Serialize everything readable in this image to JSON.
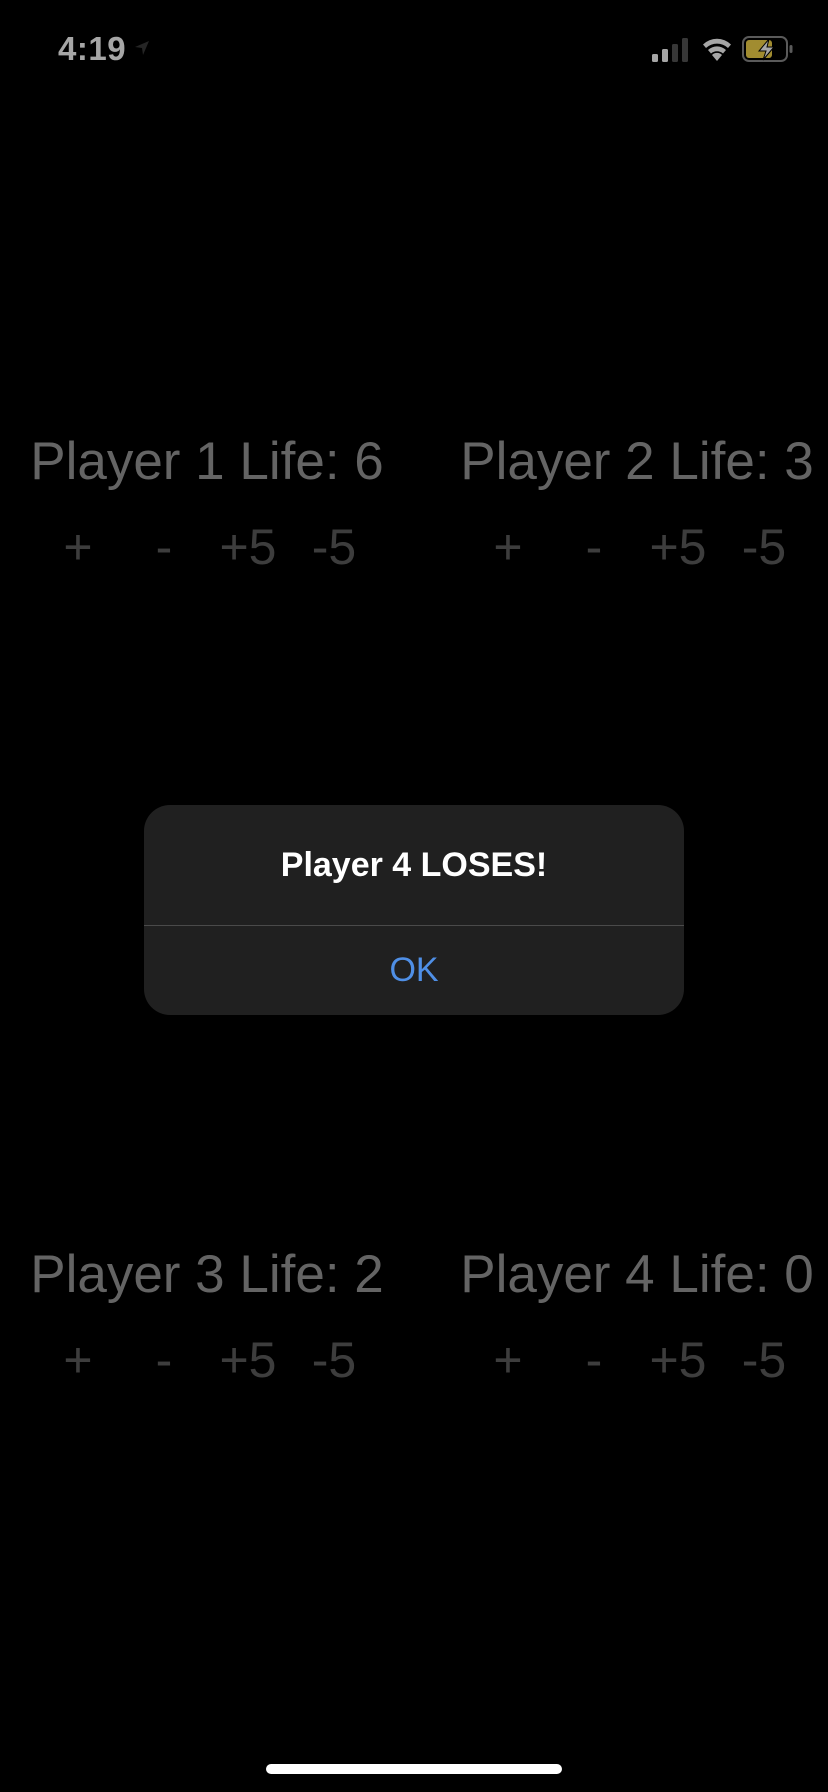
{
  "status_bar": {
    "time": "4:19",
    "icons": [
      "location-arrow-icon",
      "cellular-signal-icon",
      "wifi-icon",
      "battery-charging-icon"
    ],
    "battery_color": "#f7d84a"
  },
  "players": [
    {
      "title": "Player 1 Life: 6",
      "controls": [
        "+",
        "-",
        "+5",
        "-5"
      ]
    },
    {
      "title": "Player 2 Life: 3",
      "controls": [
        "+",
        "-",
        "+5",
        "-5"
      ]
    },
    {
      "title": "Player 3 Life: 2",
      "controls": [
        "+",
        "-",
        "+5",
        "-5"
      ]
    },
    {
      "title": "Player 4 Life: 0",
      "controls": [
        "+",
        "-",
        "+5",
        "-5"
      ]
    }
  ],
  "alert": {
    "title": "Player 4 LOSES!",
    "ok_label": "OK",
    "ok_color": "#4f8fe6"
  },
  "colors": {
    "background": "#000000",
    "player_title": "#9a9a9a",
    "control_text": "#5e5e5e",
    "alert_background": "#202020"
  }
}
